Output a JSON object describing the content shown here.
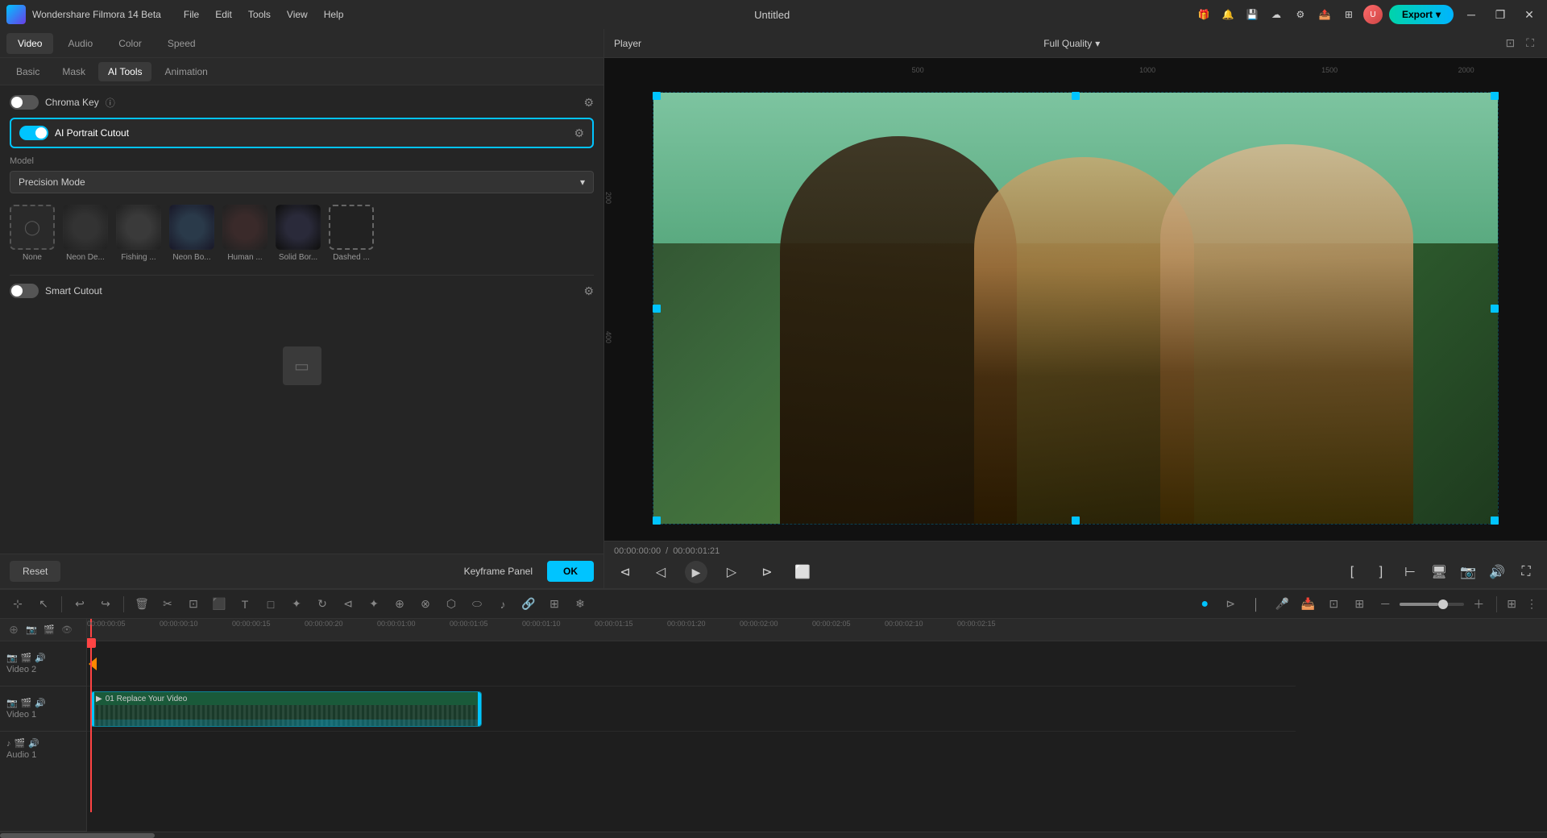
{
  "titlebar": {
    "app_name": "Wondershare Filmora 14 Beta",
    "title": "Untitled",
    "menu": [
      "File",
      "Edit",
      "Tools",
      "View",
      "Help"
    ],
    "export_label": "Export"
  },
  "tabs": {
    "main": [
      "Video",
      "Audio",
      "Color",
      "Speed"
    ],
    "active_main": "Video",
    "sub": [
      "Basic",
      "Mask",
      "AI Tools",
      "Animation"
    ],
    "active_sub": "AI Tools"
  },
  "ai_tools": {
    "chroma_key_label": "Chroma Key",
    "ai_portrait_label": "AI Portrait Cutout",
    "model_label": "Model",
    "model_value": "Precision Mode",
    "effects": [
      {
        "id": "none",
        "label": "None",
        "type": "none"
      },
      {
        "id": "neon-de",
        "label": "Neon De...",
        "type": "neon-de"
      },
      {
        "id": "fishing",
        "label": "Fishing ...",
        "type": "fishing"
      },
      {
        "id": "neon-bo",
        "label": "Neon Bo...",
        "type": "neon-bo"
      },
      {
        "id": "human",
        "label": "Human ...",
        "type": "human"
      },
      {
        "id": "solid-bor",
        "label": "Solid Bor...",
        "type": "solid-bor"
      },
      {
        "id": "dashed",
        "label": "Dashed ...",
        "type": "dashed"
      }
    ],
    "smart_cutout_label": "Smart Cutout",
    "reset_label": "Reset",
    "keyframe_label": "Keyframe Panel",
    "ok_label": "OK"
  },
  "player": {
    "title": "Player",
    "quality": "Full Quality",
    "current_time": "00:00:00:00",
    "total_time": "00:00:01:21"
  },
  "timeline": {
    "tracks": [
      {
        "id": "video2",
        "label": "Video 2",
        "icons": [
          "camera",
          "film",
          "volume"
        ]
      },
      {
        "id": "video1",
        "label": "Video 1",
        "icons": [
          "camera",
          "film",
          "volume"
        ]
      },
      {
        "id": "audio1",
        "label": "Audio 1",
        "icons": [
          "music",
          "film",
          "volume"
        ]
      }
    ],
    "clip_label": "01 Replace Your Video"
  }
}
